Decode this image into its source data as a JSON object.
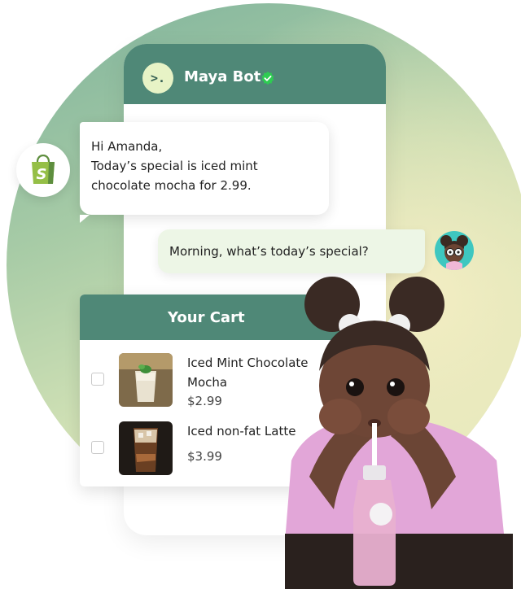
{
  "chat": {
    "bot_name": "Maya Bot",
    "bot_avatar_text": ">.",
    "incoming": {
      "line1": "Hi Amanda,",
      "line2": "Today’s special is iced mint",
      "line3": "chocolate mocha for 2.99."
    },
    "outgoing": "Morning, what’s today’s special?"
  },
  "cart": {
    "title": "Your Cart",
    "items": [
      {
        "name_line1": "Iced Mint Chocolate",
        "name_line2": "Mocha",
        "price": "$2.99"
      },
      {
        "name_line1": "Iced non-fat Latte",
        "name_line2": "",
        "price": "$3.99"
      }
    ]
  },
  "colors": {
    "header_green": "#4f8877",
    "bot_avatar_bg": "#e7f3c6",
    "user_bubble_bg": "#edf6e6",
    "shopify_green": "#95bf47"
  },
  "icons": [
    "verified-check-icon",
    "shopify-bag-icon",
    "user-avatar-icon"
  ]
}
